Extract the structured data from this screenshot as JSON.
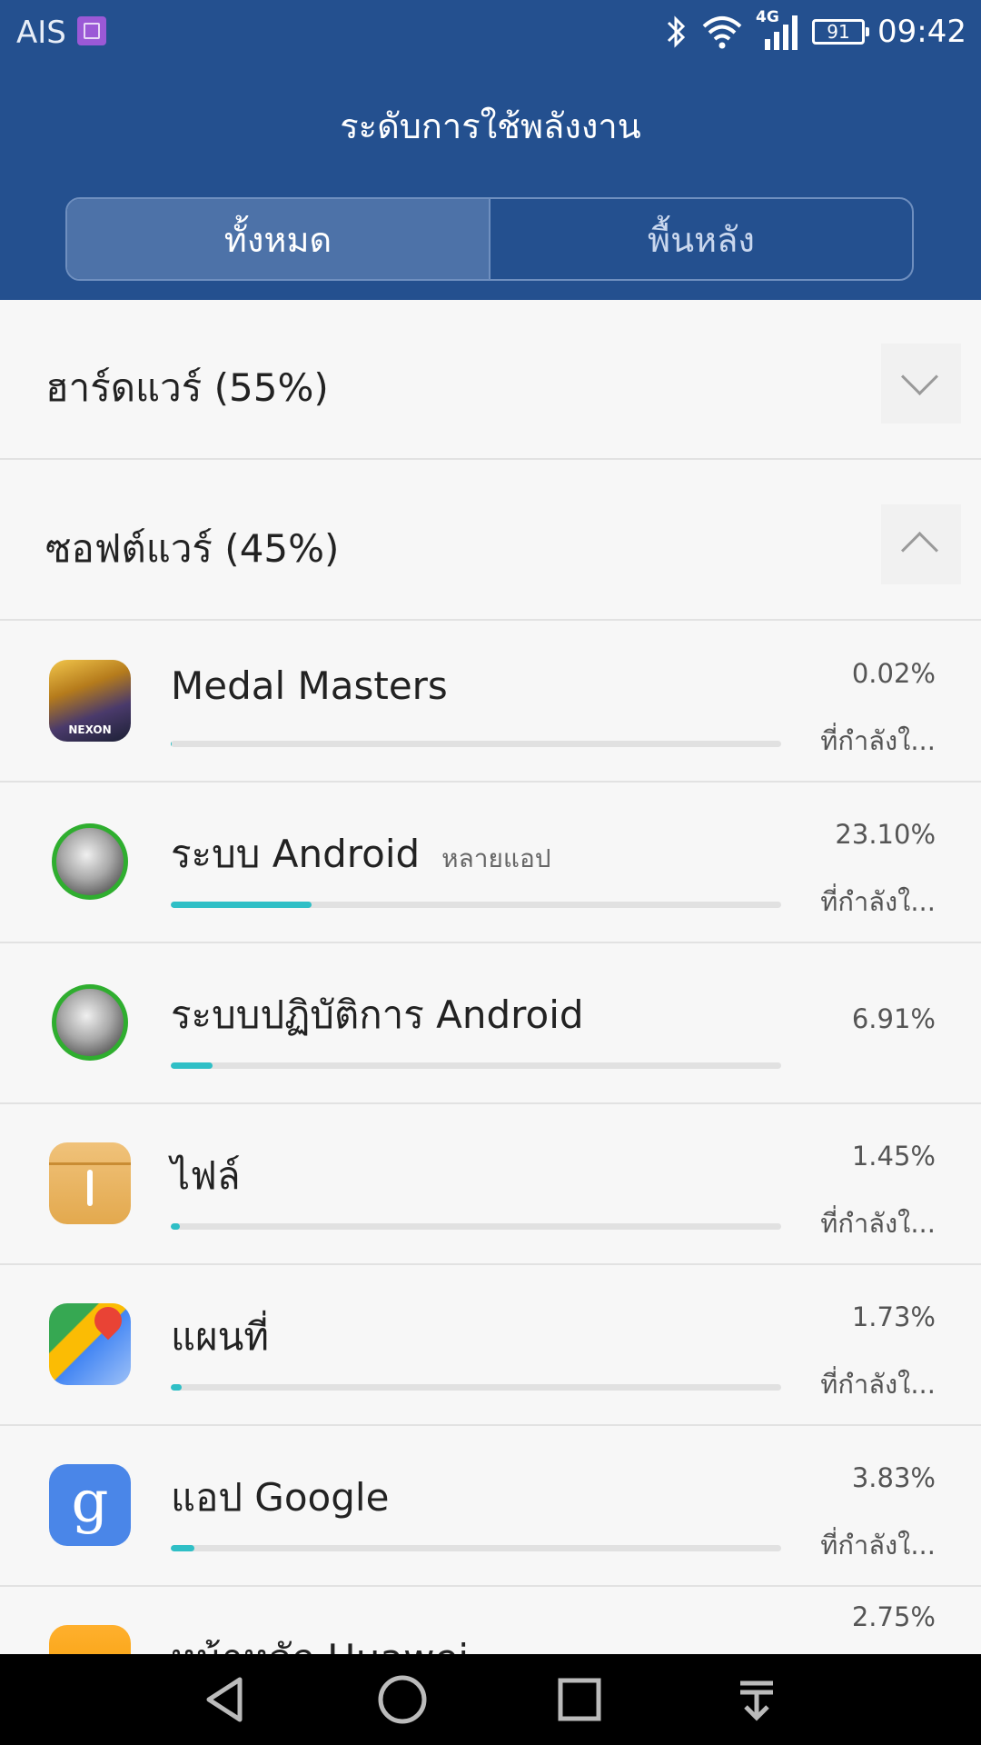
{
  "status_bar": {
    "carrier": "AIS",
    "network": "4G",
    "battery": "91",
    "time": "09:42"
  },
  "header": {
    "title": "ระดับการใช้พลังงาน",
    "tabs": [
      {
        "label": "ทั้งหมด",
        "active": true
      },
      {
        "label": "พื้นหลัง",
        "active": false
      }
    ]
  },
  "sections": {
    "hardware": {
      "title": "ฮาร์ดแวร์ (55%)",
      "expanded": false
    },
    "software": {
      "title": "ซอฟต์แวร์ (45%)",
      "expanded": true
    }
  },
  "apps": [
    {
      "name": "Medal Masters",
      "sub": "",
      "percent": "0.02%",
      "status": "ที่กำลังใ...",
      "usage": 0.02,
      "icon": "medal-masters-icon"
    },
    {
      "name": "ระบบ Android",
      "sub": "หลายแอป",
      "percent": "23.10%",
      "status": "ที่กำลังใ...",
      "usage": 23.1,
      "icon": "android-system-icon"
    },
    {
      "name": "ระบบปฏิบัติการ Android",
      "sub": "",
      "percent": "6.91%",
      "status": "",
      "usage": 6.91,
      "icon": "android-os-icon"
    },
    {
      "name": "ไฟล์",
      "sub": "",
      "percent": "1.45%",
      "status": "ที่กำลังใ...",
      "usage": 1.45,
      "icon": "files-icon"
    },
    {
      "name": "แผนที่",
      "sub": "",
      "percent": "1.73%",
      "status": "ที่กำลังใ...",
      "usage": 1.73,
      "icon": "maps-icon"
    },
    {
      "name": "แอป Google",
      "sub": "",
      "percent": "3.83%",
      "status": "ที่กำลังใ...",
      "usage": 3.83,
      "icon": "google-app-icon"
    },
    {
      "name": "หน้าหลัก Huawei",
      "sub": "",
      "percent": "2.75%",
      "status": "",
      "usage": 2.75,
      "icon": "huawei-home-icon"
    }
  ],
  "colors": {
    "header_bg": "#24508f",
    "bar_fill": "#2fbfc6",
    "tab_active": "#4d72a8"
  }
}
